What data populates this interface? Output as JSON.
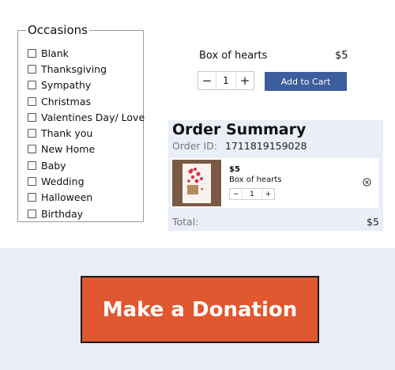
{
  "occasions": {
    "legend": "Occasions",
    "items": [
      {
        "label": "Blank"
      },
      {
        "label": "Thanksgiving"
      },
      {
        "label": "Sympathy"
      },
      {
        "label": "Christmas"
      },
      {
        "label": "Valentines Day/ Love"
      },
      {
        "label": "Thank you"
      },
      {
        "label": "New Home"
      },
      {
        "label": "Baby"
      },
      {
        "label": "Wedding"
      },
      {
        "label": "Halloween"
      },
      {
        "label": "Birthday"
      }
    ]
  },
  "product": {
    "name": "Box of hearts",
    "price": "$5",
    "quantity": "1",
    "decrement_symbol": "−",
    "increment_symbol": "+",
    "add_to_cart_label": "Add to Cart"
  },
  "order_summary": {
    "title": "Order Summary",
    "order_id_label": "Order ID:",
    "order_id": "1711819159028",
    "items": [
      {
        "price": "$5",
        "name": "Box of hearts",
        "quantity": "1"
      }
    ],
    "total_label": "Total:",
    "total_value": "$5"
  },
  "donation": {
    "button_label": "Make a Donation"
  },
  "colors": {
    "accent_blue": "#3c5e9c",
    "donate_orange": "#e1572f",
    "summary_bg": "#e9eef7"
  }
}
